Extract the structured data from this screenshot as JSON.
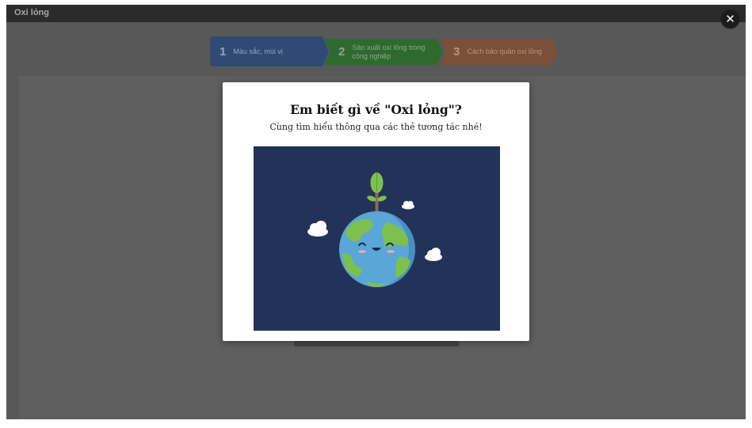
{
  "app": {
    "title": "Oxi lỏng",
    "close_icon": "close-icon"
  },
  "steps": [
    {
      "number": "1",
      "label": "Màu sắc, mùi vị",
      "color": "#2f4a74"
    },
    {
      "number": "2",
      "label": "Sản xuất oxi lỏng trong công nghiệp",
      "color": "#2e6a2e"
    },
    {
      "number": "3",
      "label": "Cách bảo quản oxi lỏng",
      "color": "#7b5038"
    }
  ],
  "modal": {
    "title": "Em biết gì về \"Oxi lỏng\"?",
    "subtitle": "Cùng tìm hiểu thông qua các thẻ tương tác nhé!",
    "image": {
      "background": "#233258",
      "subject": "smiling-earth-with-sprout"
    }
  },
  "colors": {
    "overlay": "#585858",
    "titlebar": "#2b2b2b",
    "modal": "#ffffff"
  }
}
